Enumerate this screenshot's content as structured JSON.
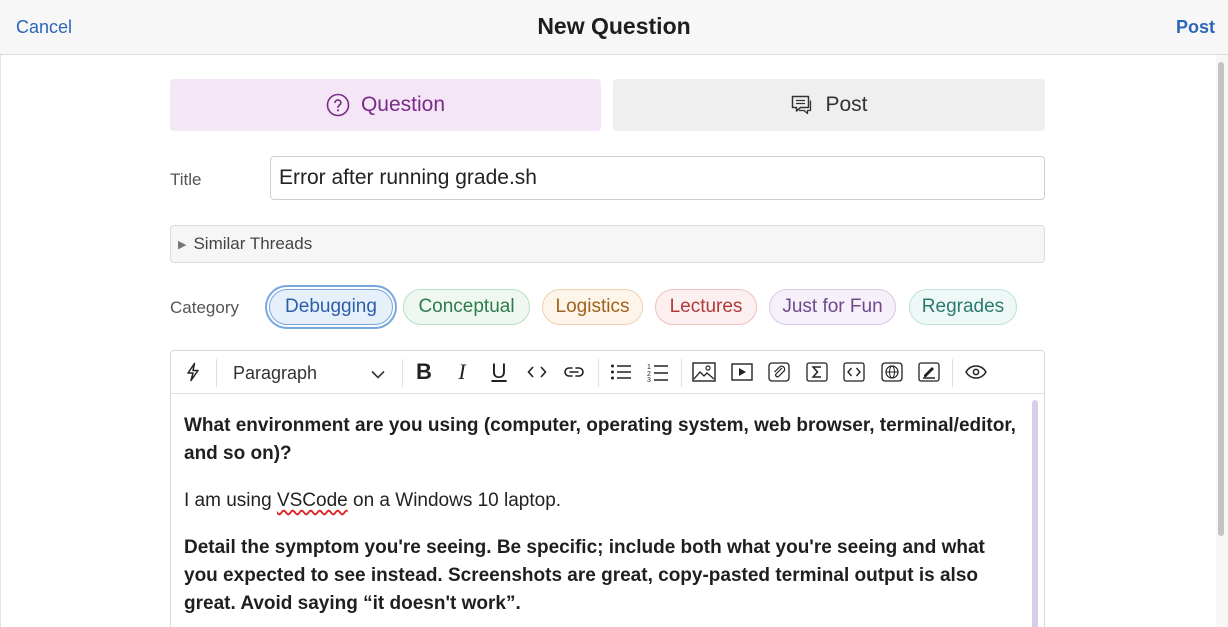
{
  "header": {
    "cancel_label": "Cancel",
    "title": "New Question",
    "post_label": "Post"
  },
  "type_tabs": {
    "question_label": "Question",
    "post_label": "Post"
  },
  "title_field": {
    "label": "Title",
    "value": "Error after running grade.sh"
  },
  "similar_threads": {
    "label": "Similar Threads"
  },
  "category": {
    "label": "Category",
    "options": [
      {
        "label": "Debugging",
        "selected": true,
        "text_color": "#2d5fa8",
        "bg": "#e6f0fb",
        "border": "#7aa7e0"
      },
      {
        "label": "Conceptual",
        "text_color": "#2f7a4e",
        "bg": "#eef8f1",
        "border": "#b9dfc6"
      },
      {
        "label": "Logistics",
        "text_color": "#a0621c",
        "bg": "#fdf5ea",
        "border": "#efd2ad"
      },
      {
        "label": "Lectures",
        "text_color": "#b03a3a",
        "bg": "#fcefef",
        "border": "#efc0c0"
      },
      {
        "label": "Just for Fun",
        "text_color": "#6e4a8a",
        "bg": "#f6f0fa",
        "border": "#d9c7e6"
      },
      {
        "label": "Regrades",
        "text_color": "#2b7a6e",
        "bg": "#eef8f6",
        "border": "#bfe2dc"
      }
    ]
  },
  "editor": {
    "toolbar": {
      "paragraph_label": "Paragraph",
      "icons": [
        "lightning-icon",
        "bold-icon",
        "italic-icon",
        "underline-icon",
        "inline-code-icon",
        "link-icon",
        "bullet-list-icon",
        "numbered-list-icon",
        "image-icon",
        "video-icon",
        "attachment-icon",
        "math-icon",
        "code-block-icon",
        "web-embed-icon",
        "annotate-icon",
        "preview-eye-icon"
      ]
    },
    "content": {
      "q1": "What environment are you using (computer, operating system, web browser, terminal/editor, and so on)?",
      "a1_before": "I am using ",
      "a1_misspelled": "VSCode",
      "a1_after": " on a Windows 10 laptop.",
      "q2": "Detail the symptom you're seeing. Be specific; include both what you're seeing and what you expected to see instead. Screenshots are great, copy-pasted terminal output is also great. Avoid saying “it doesn't work”."
    }
  }
}
